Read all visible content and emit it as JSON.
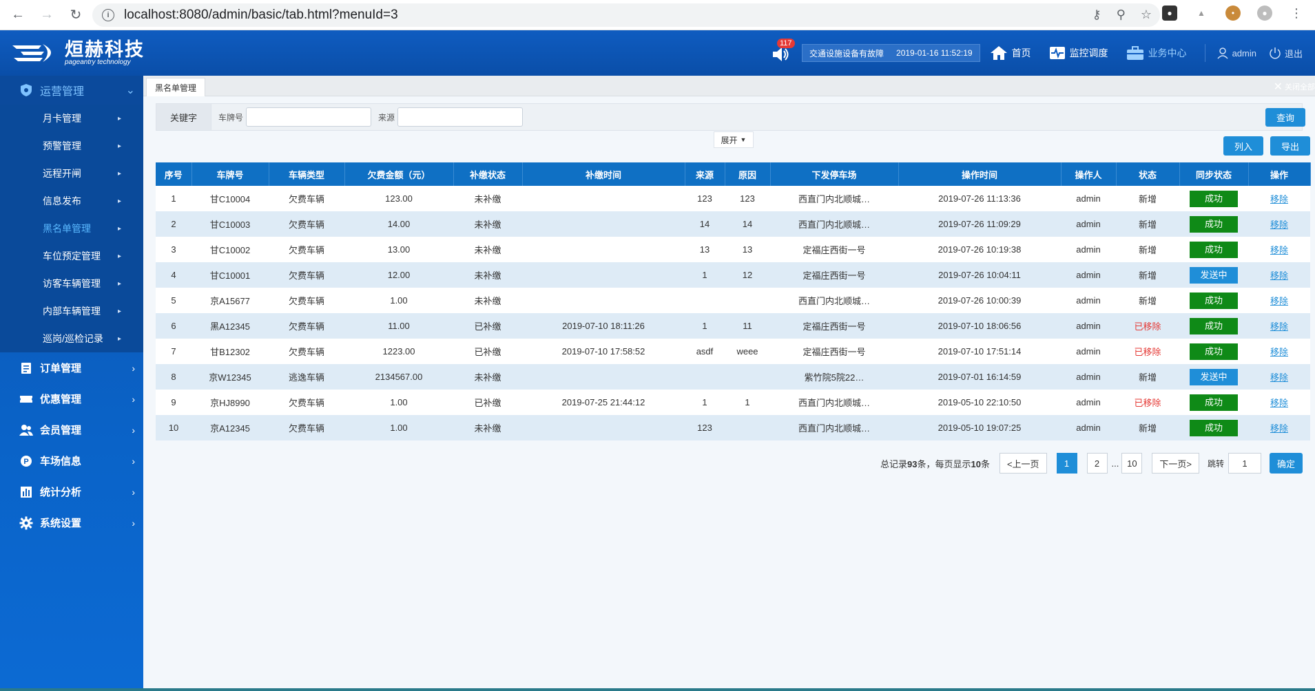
{
  "browser": {
    "url": "localhost:8080/admin/basic/tab.html?menuId=3"
  },
  "header": {
    "logo_cn": "烜赫科技",
    "logo_en": "pageantry technology",
    "badge_count": "117",
    "alert_text": "交通设施设备有故障",
    "alert_time": "2019-01-16 11:52:19",
    "nav": [
      {
        "label": "首页"
      },
      {
        "label": "监控调度"
      },
      {
        "label": "业务中心"
      }
    ],
    "user": "admin",
    "logout": "退出"
  },
  "sidebar": {
    "top": {
      "label": "运营管理"
    },
    "sub_items": [
      {
        "label": "月卡管理"
      },
      {
        "label": "预警管理"
      },
      {
        "label": "远程开闸"
      },
      {
        "label": "信息发布"
      },
      {
        "label": "黑名单管理"
      },
      {
        "label": "车位预定管理"
      },
      {
        "label": "访客车辆管理"
      },
      {
        "label": "内部车辆管理"
      },
      {
        "label": "巡岗/巡检记录"
      }
    ],
    "groups": [
      {
        "label": "订单管理"
      },
      {
        "label": "优惠管理"
      },
      {
        "label": "会员管理"
      },
      {
        "label": "车场信息"
      },
      {
        "label": "统计分析"
      },
      {
        "label": "系统设置"
      }
    ]
  },
  "tabs": {
    "current": "黑名单管理",
    "close_all": "关闭全部"
  },
  "filter": {
    "keyword_label": "关键字",
    "plate_label": "车牌号",
    "source_label": "来源",
    "query_btn": "查询",
    "expand_btn": "展开",
    "enlist_btn": "列入",
    "export_btn": "导出"
  },
  "table": {
    "headers": [
      "序号",
      "车牌号",
      "车辆类型",
      "欠费金额（元）",
      "补缴状态",
      "补缴时间",
      "来源",
      "原因",
      "下发停车场",
      "操作时间",
      "操作人",
      "状态",
      "同步状态",
      "操作"
    ],
    "rows": [
      [
        "1",
        "甘C10004",
        "欠费车辆",
        "123.00",
        "未补缴",
        "",
        "123",
        "123",
        "西直门内北顺城…",
        "2019-07-26 11:13:36",
        "admin",
        "新增",
        "成功",
        "移除"
      ],
      [
        "2",
        "甘C10003",
        "欠费车辆",
        "14.00",
        "未补缴",
        "",
        "14",
        "14",
        "西直门内北顺城…",
        "2019-07-26 11:09:29",
        "admin",
        "新增",
        "成功",
        "移除"
      ],
      [
        "3",
        "甘C10002",
        "欠费车辆",
        "13.00",
        "未补缴",
        "",
        "13",
        "13",
        "定福庄西街一号",
        "2019-07-26 10:19:38",
        "admin",
        "新增",
        "成功",
        "移除"
      ],
      [
        "4",
        "甘C10001",
        "欠费车辆",
        "12.00",
        "未补缴",
        "",
        "1",
        "12",
        "定福庄西街一号",
        "2019-07-26 10:04:11",
        "admin",
        "新增",
        "发送中",
        "移除"
      ],
      [
        "5",
        "京A15677",
        "欠费车辆",
        "1.00",
        "未补缴",
        "",
        "",
        "",
        "西直门内北顺城…",
        "2019-07-26 10:00:39",
        "admin",
        "新增",
        "成功",
        "移除"
      ],
      [
        "6",
        "黑A12345",
        "欠费车辆",
        "11.00",
        "已补缴",
        "2019-07-10 18:11:26",
        "1",
        "11",
        "定福庄西街一号",
        "2019-07-10 18:06:56",
        "admin",
        "已移除",
        "成功",
        "移除"
      ],
      [
        "7",
        "甘B12302",
        "欠费车辆",
        "1223.00",
        "已补缴",
        "2019-07-10 17:58:52",
        "asdf",
        "weee",
        "定福庄西街一号",
        "2019-07-10 17:51:14",
        "admin",
        "已移除",
        "成功",
        "移除"
      ],
      [
        "8",
        "京W12345",
        "逃逸车辆",
        "2134567.00",
        "未补缴",
        "",
        "",
        "",
        "紫竹院5院22…",
        "2019-07-01 16:14:59",
        "admin",
        "新增",
        "发送中",
        "移除"
      ],
      [
        "9",
        "京HJ8990",
        "欠费车辆",
        "1.00",
        "已补缴",
        "2019-07-25 21:44:12",
        "1",
        "1",
        "西直门内北顺城…",
        "2019-05-10 22:10:50",
        "admin",
        "已移除",
        "成功",
        "移除"
      ],
      [
        "10",
        "京A12345",
        "欠费车辆",
        "1.00",
        "未补缴",
        "",
        "123",
        "",
        "西直门内北顺城…",
        "2019-05-10 19:07:25",
        "admin",
        "新增",
        "成功",
        "移除"
      ]
    ]
  },
  "pager": {
    "total_prefix": "总记录",
    "total": "93",
    "total_mid": "条，每页显示",
    "per_page": "10",
    "total_suffix": "条",
    "prev": "<上一页",
    "pages": [
      "1",
      "2"
    ],
    "ellipsis": "...",
    "last": "10",
    "next": "下一页>",
    "jump_label": "跳转",
    "jump_value": "1",
    "confirm": "确定"
  },
  "colors": {
    "header_blue": "#0f5cc0",
    "table_header": "#0f70c4",
    "success_green": "#0f8a17",
    "sending_blue": "#1f8ed8",
    "removed_red": "#e53935"
  }
}
